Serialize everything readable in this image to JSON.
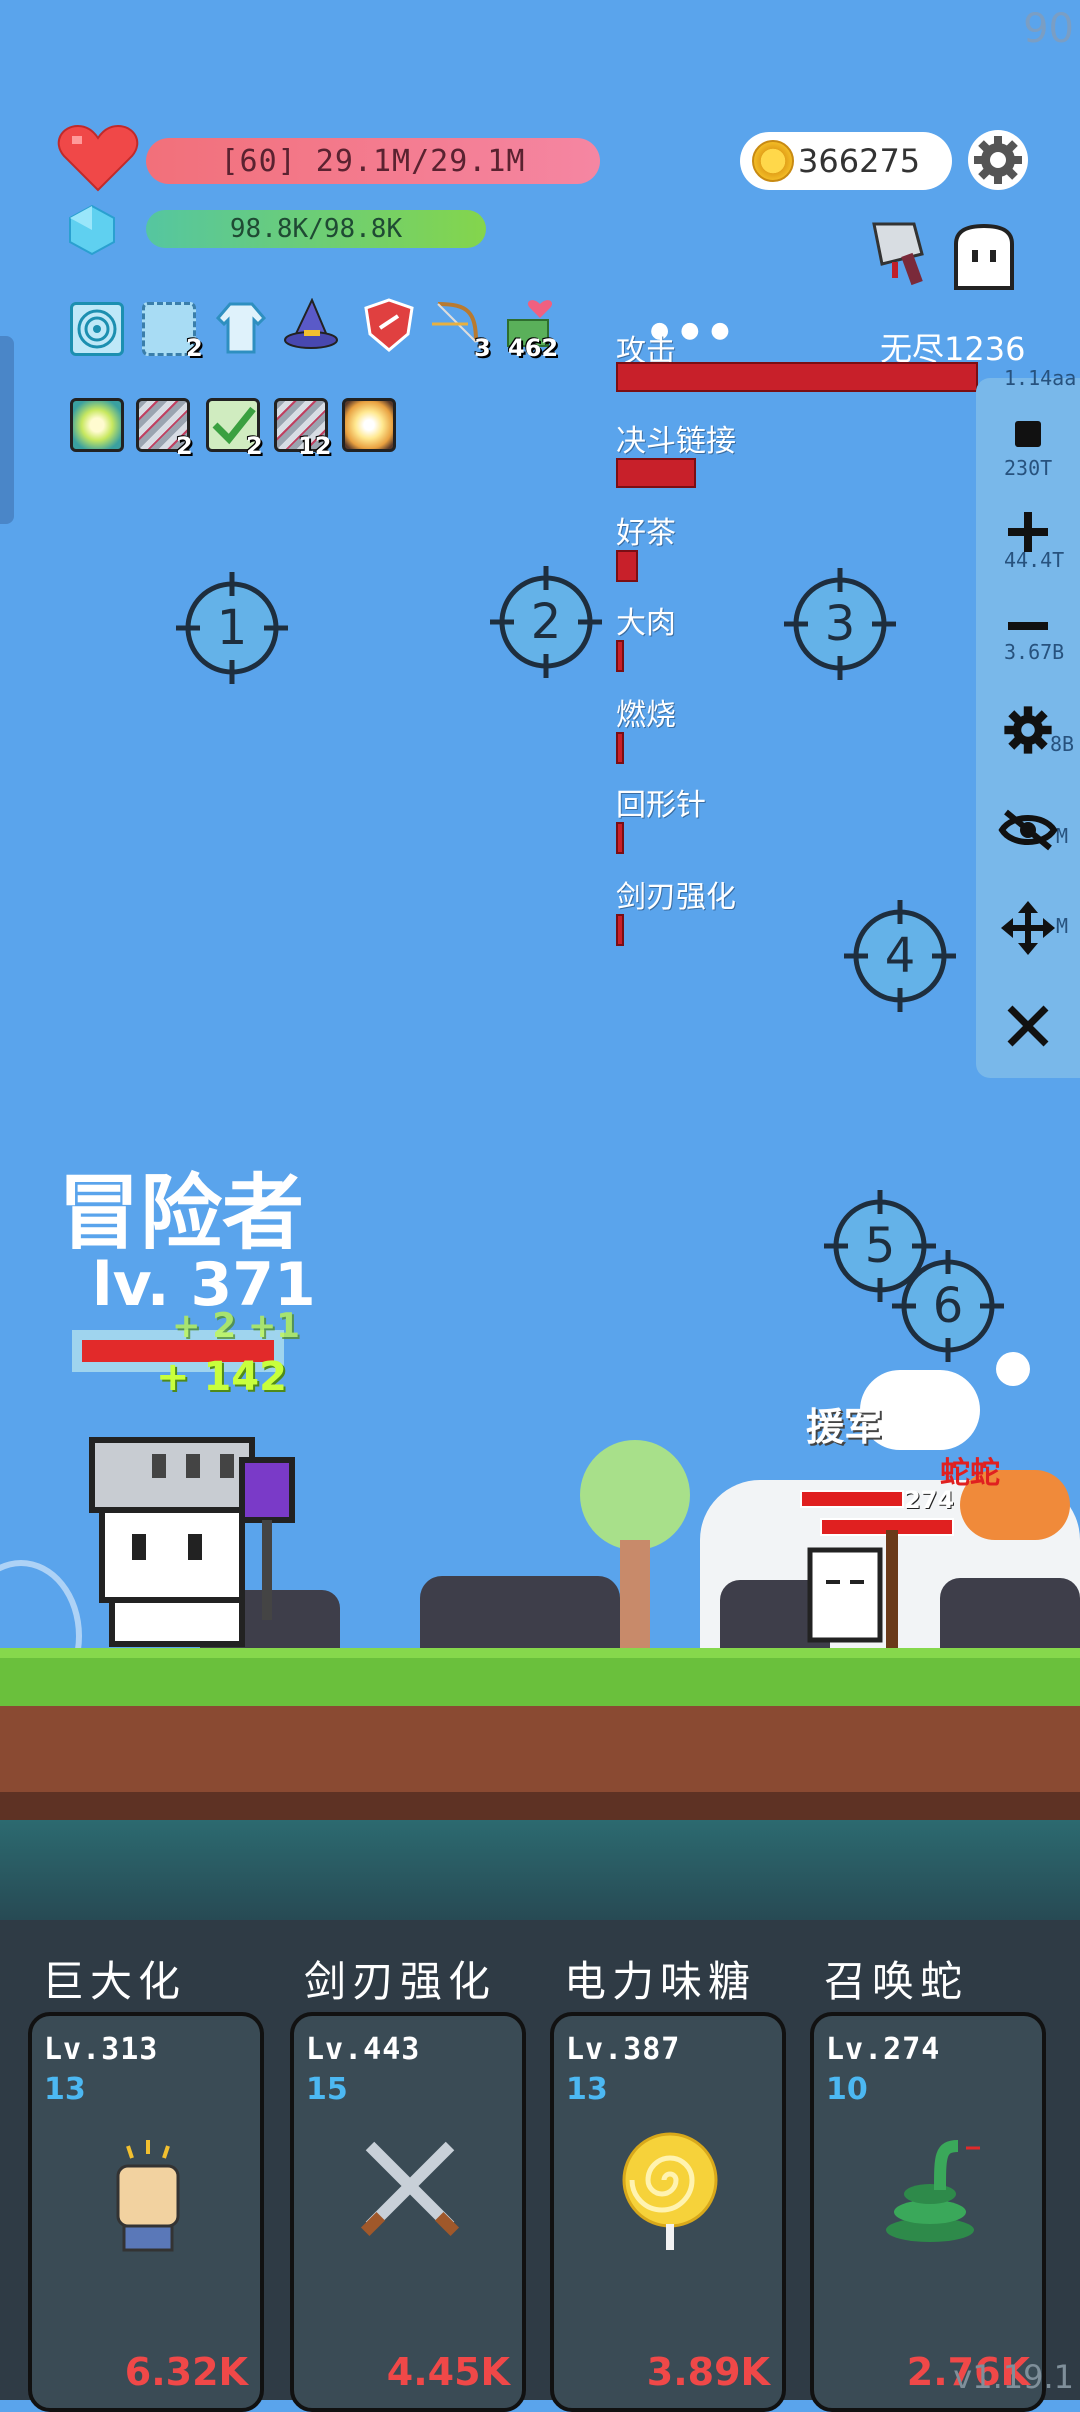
{
  "fps": "90",
  "hud": {
    "hp_text": "[60] 29.1M/29.1M",
    "mp_text": "98.8K/98.8K",
    "coins": "366275",
    "hp_color": "#f2707a",
    "mp_color": "#84d54c"
  },
  "buffs_row1": [
    {
      "icon": "spiral-target-icon",
      "count": ""
    },
    {
      "icon": "ice-cube-icon",
      "count": "2"
    },
    {
      "icon": "robe-icon",
      "count": ""
    },
    {
      "icon": "wizard-hat-icon",
      "count": ""
    },
    {
      "icon": "shield-icon",
      "count": ""
    },
    {
      "icon": "bow-icon",
      "count": "3"
    },
    {
      "icon": "heart-money-icon",
      "count": "462"
    }
  ],
  "buffs_row2": [
    {
      "icon": "glow-orb-icon",
      "count": ""
    },
    {
      "icon": "blades-icon",
      "count": "2"
    },
    {
      "icon": "green-arrow-icon",
      "count": "2"
    },
    {
      "icon": "blades-icon",
      "count": "12"
    },
    {
      "icon": "burst-icon",
      "count": ""
    }
  ],
  "stats": {
    "endless": "无尽1236",
    "items": [
      {
        "label": "攻击",
        "fill": 1.0
      },
      {
        "label": "决斗链接",
        "fill": 0.22
      },
      {
        "label": "好茶",
        "fill": 0.06
      },
      {
        "label": "大肉",
        "fill": 0.02
      },
      {
        "label": "燃烧",
        "fill": 0.02
      },
      {
        "label": "回形针",
        "fill": 0.02
      },
      {
        "label": "剑刃强化",
        "fill": 0.02
      }
    ]
  },
  "side_panel": {
    "values": [
      "1.14aa",
      "230T",
      "44.4T",
      "3.67B",
      "8B",
      "M",
      "M"
    ],
    "buttons": [
      "stop-icon",
      "plus-icon",
      "minus-icon",
      "gear-icon",
      "eye-off-icon",
      "move-icon",
      "close-icon"
    ]
  },
  "crosshairs": [
    "1",
    "2",
    "3",
    "4",
    "5",
    "6"
  ],
  "player": {
    "name": "冒险者",
    "level": "lv. 371",
    "heal_1": "+ 2 +1",
    "heal_2": "+ 142"
  },
  "enemy": {
    "label_1": "援军",
    "label_2": "蛇蛇",
    "number": "274"
  },
  "skills": [
    {
      "name": "巨大化",
      "level": "Lv.313",
      "count": "13",
      "price": "6.32K",
      "icon": "raised-fist-icon"
    },
    {
      "name": "剑刃强化",
      "level": "Lv.443",
      "count": "15",
      "price": "4.45K",
      "icon": "crossed-swords-icon"
    },
    {
      "name": "电力味糖",
      "level": "Lv.387",
      "count": "13",
      "price": "3.89K",
      "icon": "lollipop-icon"
    },
    {
      "name": "召唤蛇",
      "level": "Lv.274",
      "count": "10",
      "price": "2.76K",
      "icon": "snake-icon"
    }
  ],
  "version": "v1.19.1"
}
